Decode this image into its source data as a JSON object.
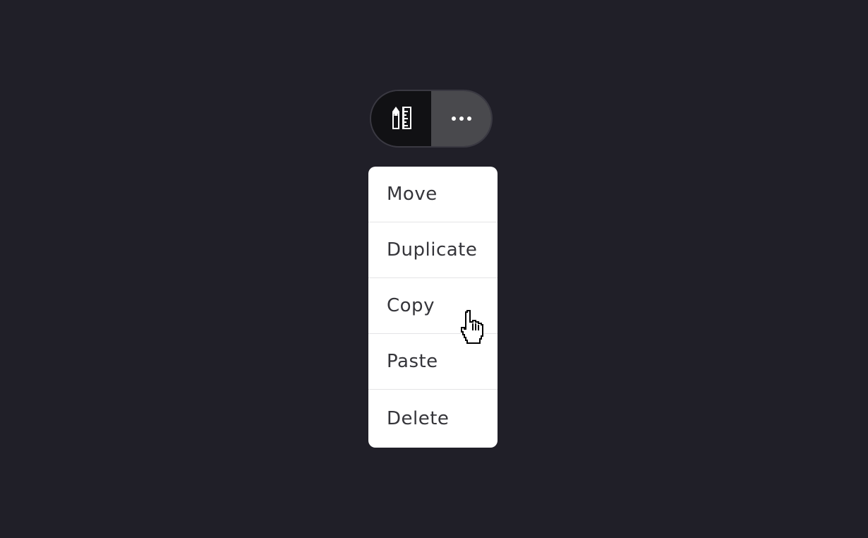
{
  "toolbar": {
    "edit_tools_icon": "pencil-ruler-icon",
    "more_icon": "more-horizontal-icon"
  },
  "menu": {
    "items": [
      {
        "label": "Move"
      },
      {
        "label": "Duplicate"
      },
      {
        "label": "Copy"
      },
      {
        "label": "Paste"
      },
      {
        "label": "Delete"
      }
    ]
  },
  "cursor": {
    "icon": "hand-pointer-cursor-icon"
  },
  "colors": {
    "background": "#201f28",
    "pill_left": "#111114",
    "pill_right": "#49494d",
    "menu_bg": "#ffffff",
    "menu_text": "#35353a"
  }
}
